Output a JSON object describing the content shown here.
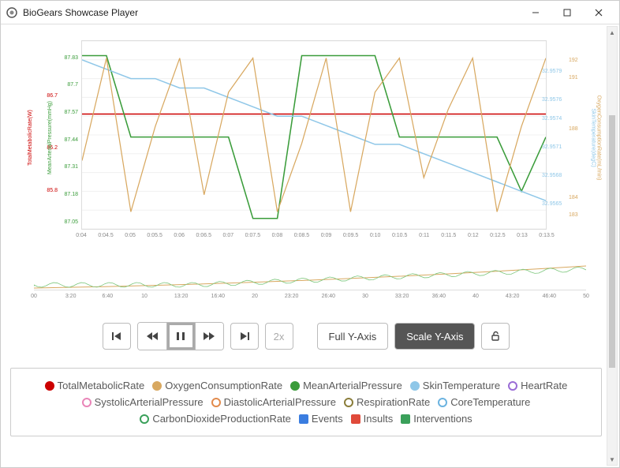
{
  "window": {
    "title": "BioGears Showcase Player"
  },
  "controls": {
    "speed_label": "2x",
    "full_y_label": "Full Y-Axis",
    "scale_y_label": "Scale Y-Axis"
  },
  "legend": [
    {
      "label": "TotalMetabolicRate",
      "color": "#cc0000",
      "style": "filled-circle",
      "selected": true
    },
    {
      "label": "OxygenConsumptionRate",
      "color": "#d8a860",
      "style": "filled-circle",
      "selected": true
    },
    {
      "label": "MeanArterialPressure",
      "color": "#3a9c3a",
      "style": "filled-circle",
      "selected": true
    },
    {
      "label": "SkinTemperature",
      "color": "#8fc7e8",
      "style": "filled-circle",
      "selected": true
    },
    {
      "label": "HeartRate",
      "color": "#9a6cd6",
      "style": "ring",
      "selected": false
    },
    {
      "label": "SystolicArterialPressure",
      "color": "#e985b8",
      "style": "ring",
      "selected": false
    },
    {
      "label": "DiastolicArterialPressure",
      "color": "#e28b4d",
      "style": "ring",
      "selected": false
    },
    {
      "label": "RespirationRate",
      "color": "#8a7d3a",
      "style": "ring",
      "selected": false
    },
    {
      "label": "CoreTemperature",
      "color": "#6bb3e0",
      "style": "ring",
      "selected": false
    },
    {
      "label": "CarbonDioxideProductionRate",
      "color": "#3aa05a",
      "style": "ring",
      "selected": false
    },
    {
      "label": "Events",
      "color": "#3a7de0",
      "style": "square",
      "selected": true
    },
    {
      "label": "Insults",
      "color": "#e04a3a",
      "style": "square",
      "selected": true
    },
    {
      "label": "Interventions",
      "color": "#3aa05a",
      "style": "square",
      "selected": true
    }
  ],
  "chart_data": {
    "type": "line",
    "x_ticks": [
      "0:04",
      "0:04.5",
      "0:05",
      "0:05.5",
      "0:06",
      "0:06.5",
      "0:07",
      "0:07.5",
      "0:08",
      "0:08.5",
      "0:09",
      "0:09.5",
      "0:10",
      "0:10.5",
      "0:11",
      "0:11.5",
      "0:12",
      "0:12.5",
      "0:13",
      "0:13.5"
    ],
    "axes": {
      "left1": {
        "label": "TotalMetabolicRate(W)",
        "color": "#cc0000",
        "ticks": [
          85.8,
          86.2,
          86.7
        ],
        "range": [
          85.4,
          87.2
        ]
      },
      "left2": {
        "label": "MeanArterialPressure(mmHg)",
        "color": "#3a9c3a",
        "ticks": [
          87.05,
          87.18,
          87.31,
          87.44,
          87.57,
          87.7,
          87.83
        ],
        "range": [
          87.0,
          87.9
        ]
      },
      "right1": {
        "label": "SkinTemperature(degC)",
        "color": "#8fc7e8",
        "ticks": [
          32.9565,
          32.9568,
          32.9571,
          32.9574,
          32.9576,
          32.9579
        ],
        "range": [
          32.9562,
          32.9582
        ]
      },
      "right2": {
        "label": "OxygenConsumptionRate(mL/min)",
        "color": "#d8a860",
        "ticks": [
          183,
          184,
          188,
          191,
          192
        ],
        "range": [
          182,
          193
        ]
      }
    },
    "series": [
      {
        "name": "TotalMetabolicRate",
        "color": "#cc0000",
        "axis": "left1",
        "y": [
          86.5,
          86.5,
          86.5,
          86.5,
          86.5,
          86.5,
          86.5,
          86.5,
          86.5,
          86.5,
          86.5,
          86.5,
          86.5,
          86.5,
          86.5,
          86.5,
          86.5,
          86.5,
          86.5,
          86.5
        ]
      },
      {
        "name": "MeanArterialPressure",
        "color": "#3a9c3a",
        "axis": "left2",
        "y": [
          87.83,
          87.83,
          87.44,
          87.44,
          87.44,
          87.44,
          87.44,
          87.05,
          87.05,
          87.83,
          87.83,
          87.83,
          87.83,
          87.44,
          87.44,
          87.44,
          87.44,
          87.44,
          87.18,
          87.44
        ]
      },
      {
        "name": "SkinTemperature",
        "color": "#8fc7e8",
        "axis": "right1",
        "y": [
          32.958,
          32.9579,
          32.9578,
          32.9578,
          32.9577,
          32.9577,
          32.9576,
          32.9575,
          32.9574,
          32.9574,
          32.9573,
          32.9572,
          32.9571,
          32.9571,
          32.957,
          32.9569,
          32.9568,
          32.9567,
          32.9566,
          32.9565
        ]
      },
      {
        "name": "OxygenConsumptionRate",
        "color": "#d8a860",
        "axis": "right2",
        "y": [
          186,
          192,
          183,
          188,
          192,
          184,
          190,
          192,
          183,
          187,
          192,
          183,
          190,
          192,
          185,
          189,
          192,
          183,
          188,
          192
        ]
      }
    ]
  },
  "overview": {
    "ticks": [
      "00",
      "3:20",
      "6:40",
      "10",
      "13:20",
      "16:40",
      "20",
      "23:20",
      "26:40",
      "30",
      "33:20",
      "36:40",
      "40",
      "43:20",
      "46:40",
      "50"
    ],
    "window_start": 0.02,
    "window_end": 0.28
  }
}
